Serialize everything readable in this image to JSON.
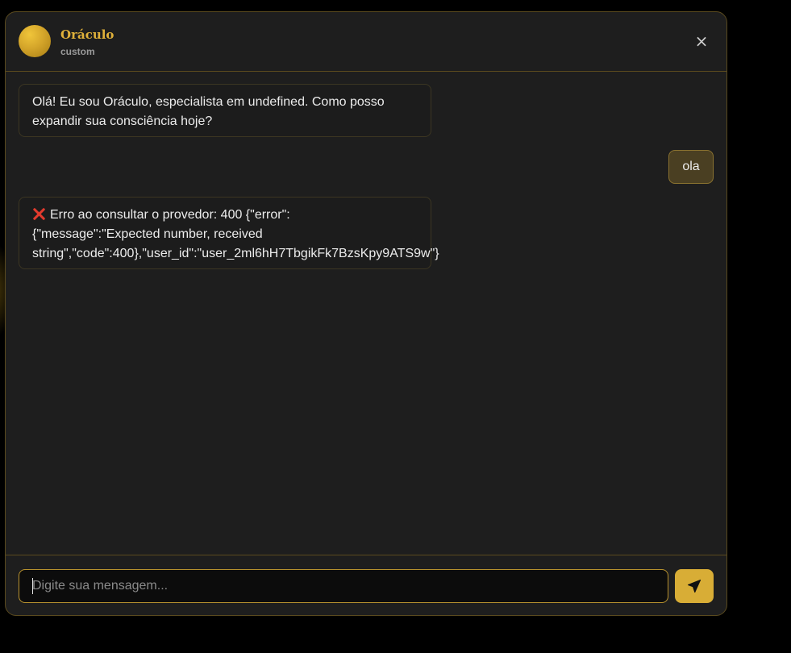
{
  "header": {
    "name": "Oráculo",
    "subtitle": "custom",
    "close_icon": "×"
  },
  "messages": [
    {
      "role": "assistant",
      "text": "Olá! Eu sou Oráculo, especialista em undefined. Como posso expandir sua consciência hoje?"
    },
    {
      "role": "user",
      "text": "ola"
    },
    {
      "role": "assistant",
      "line1": "Erro ao consultar o provedor: 400 {\"error\":",
      "line2": "{\"message\":\"Expected number, received",
      "line3": "string\",\"code\":400},\"user_id\":\"user_2ml6hH7TbgikFk7BzsKpy9ATS9w\"}",
      "icon": "x-mark-icon"
    }
  ],
  "composer": {
    "placeholder": "Digite sua mensagem...",
    "value": "",
    "send_icon": "paper-plane-icon"
  },
  "colors": {
    "accent": "#d8ad36",
    "panel": "#1e1e1e",
    "border": "#5a4a1e",
    "user_bubble": "#4a3f22",
    "error": "#e23b2e"
  }
}
